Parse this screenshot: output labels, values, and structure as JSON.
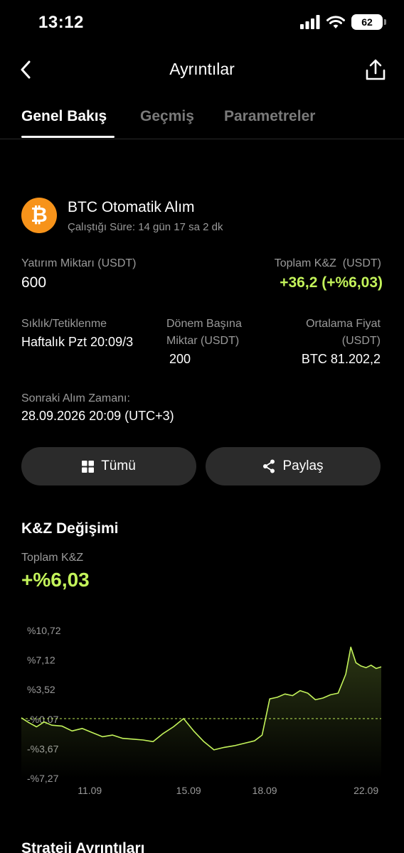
{
  "status": {
    "time": "13:12",
    "battery": "62"
  },
  "nav": {
    "title": "Ayrıntılar"
  },
  "tabs": [
    {
      "label": "Genel Bakış",
      "active": true
    },
    {
      "label": "Geçmiş",
      "active": false
    },
    {
      "label": "Parametreler",
      "active": false
    }
  ],
  "bot": {
    "coin_symbol": "₿",
    "name": "BTC Otomatik Alım",
    "runtime": "Çalıştığı Süre: 14 gün 17 sa 2 dk"
  },
  "investment": {
    "label": "Yatırım Miktarı (USDT)",
    "value": "600"
  },
  "pnl": {
    "label": "Toplam K&Z  (USDT)",
    "value": "+36,2 (+%6,03)"
  },
  "frequency": {
    "label": "Sıklık/Tetiklenme",
    "value": "Haftalık Pzt 20:09/3"
  },
  "per_period": {
    "label_line1": "Dönem Başına",
    "label_line2": "Miktar (USDT)",
    "value": "200"
  },
  "avg_price": {
    "label_line1": "Ortalama Fiyat",
    "label_line2": "(USDT)",
    "value": "BTC 81.202,2"
  },
  "next_buy": {
    "label": "Sonraki Alım Zamanı:",
    "value": "28.09.2026 20:09 (UTC+3)"
  },
  "buttons": {
    "all_label": "Tümü",
    "share_label": "Paylaş"
  },
  "pnl_change": {
    "section_title": "K&Z Değişimi",
    "total_label": "Toplam K&Z",
    "total_value": "+%6,03"
  },
  "strategy": {
    "section_title": "Strateji Ayrıntıları"
  },
  "colors": {
    "accent_green": "#c3f35a",
    "btc_orange": "#f7931a",
    "button_bg": "#2b2b2b"
  },
  "chart_data": {
    "type": "area",
    "y_tick_labels": [
      "%10,72",
      "%7,12",
      "%3,52",
      "-%0,07",
      "-%3,67",
      "-%7,27"
    ],
    "y_ticks": [
      10.72,
      7.12,
      3.52,
      -0.07,
      -3.67,
      -7.27
    ],
    "x_tick_labels": [
      "11.09",
      "15.09",
      "18.09",
      "22.09"
    ],
    "x_ticks": [
      10.7,
      14.6,
      17.6,
      21.6
    ],
    "ylim": [
      -7.27,
      10.72
    ],
    "xlim": [
      8.0,
      22.2
    ],
    "baseline": 0,
    "grid": false,
    "series": [
      {
        "x": [
          8.0,
          8.3,
          8.6,
          8.9,
          9.2,
          9.6,
          10.0,
          10.4,
          10.8,
          11.2,
          11.6,
          12.0,
          12.4,
          12.8,
          13.2,
          13.6,
          14.0,
          14.4,
          14.8,
          15.2,
          15.6,
          16.0,
          16.4,
          16.8,
          17.2,
          17.5,
          17.8,
          18.1,
          18.4,
          18.7,
          19.0,
          19.3,
          19.6,
          19.9,
          20.2,
          20.5,
          20.8,
          21.0,
          21.2,
          21.4,
          21.6,
          21.8,
          22.0,
          22.2
        ],
        "values": [
          0.1,
          -0.5,
          -1.0,
          -0.4,
          -0.8,
          -0.9,
          -1.5,
          -1.2,
          -1.7,
          -2.2,
          -2.0,
          -2.4,
          -2.5,
          -2.6,
          -2.8,
          -1.8,
          -1.0,
          0.0,
          -1.5,
          -2.8,
          -3.8,
          -3.5,
          -3.3,
          -3.0,
          -2.7,
          -2.0,
          2.4,
          2.6,
          3.0,
          2.8,
          3.4,
          3.1,
          2.3,
          2.5,
          2.9,
          3.1,
          5.4,
          8.7,
          6.8,
          6.4,
          6.2,
          6.5,
          6.1,
          6.3
        ]
      }
    ]
  }
}
